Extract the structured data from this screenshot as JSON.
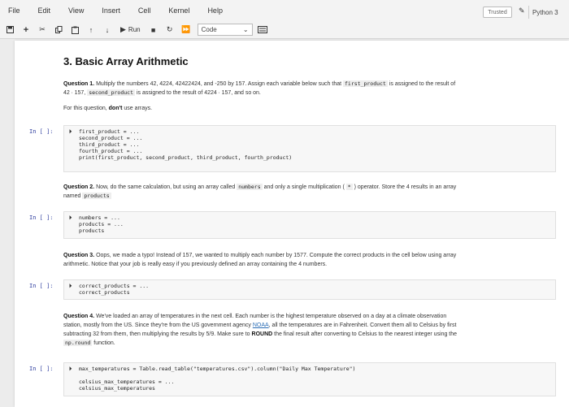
{
  "menu": [
    "File",
    "Edit",
    "View",
    "Insert",
    "Cell",
    "Kernel",
    "Help"
  ],
  "header": {
    "trusted": "Trusted",
    "kernel": "Python 3"
  },
  "toolbar": {
    "run_label": "Run",
    "cell_type": "Code"
  },
  "section_title": "3. Basic Array Arithmetic",
  "q1": {
    "lead": "Question 1.",
    "text": " Multiply the numbers 42, 4224, 42422424, and -250 by 157. Assign each variable below such that ",
    "var1": "first_product",
    "text2": " is assigned to the result of",
    "line2a": "42 ∙ 157, ",
    "var2": "second_product",
    "line2b": " is assigned to the result of 4224 ∙ 157, and so on.",
    "note_pre": "For this question, ",
    "note_bold": "don't",
    "note_post": " use arrays."
  },
  "q2": {
    "lead": "Question 2.",
    "text": " Now, do the same calculation, but using an array called ",
    "var": "numbers",
    "text2": " and only a single multiplication ( ",
    "op": "*",
    "text3": " ) operator. Store the 4 results in an array",
    "line2": "named ",
    "var2": "products"
  },
  "q3": {
    "lead": "Question 3.",
    "text": " Oops, we made a typo! Instead of 157, we wanted to multiply each number by 1577. Compute the correct products in the cell below using array",
    "line2": "arithmetic. Notice that your job is really easy if you previously defined an array containing the 4 numbers."
  },
  "q4": {
    "lead": "Question 4.",
    "text": " We've loaded an array of temperatures in the next cell. Each number is the highest temperature observed on a day at a climate observation",
    "line2a": "station, mostly from the US. Since they're from the US government agency ",
    "link": "NOAA",
    "line2b": ", all the temperatures are in Fahrenheit. Convert them all to Celsius by first",
    "line3a": "subtracting 32 from them, then multiplying the results by ",
    "frac": "5/9",
    "line3b": ". Make sure to ",
    "bold": "ROUND",
    "line3c": " the final result after converting to Celsius to the nearest integer using the",
    "func": "np.round",
    "line4": " function."
  },
  "prompt_label": "In [ ]:",
  "cells": {
    "c1": [
      "first_product = ...",
      "second_product = ...",
      "third_product = ...",
      "fourth_product = ...",
      "print(first_product, second_product, third_product, fourth_product)"
    ],
    "c2": [
      "numbers = ...",
      "products = ...",
      "products"
    ],
    "c3": [
      "correct_products = ...",
      "correct_products"
    ],
    "c4": [
      "max_temperatures = Table.read_table(\"temperatures.csv\").column(\"Daily Max Temperature\")",
      "",
      "celsius_max_temperatures = ...",
      "celsius_max_temperatures"
    ]
  }
}
